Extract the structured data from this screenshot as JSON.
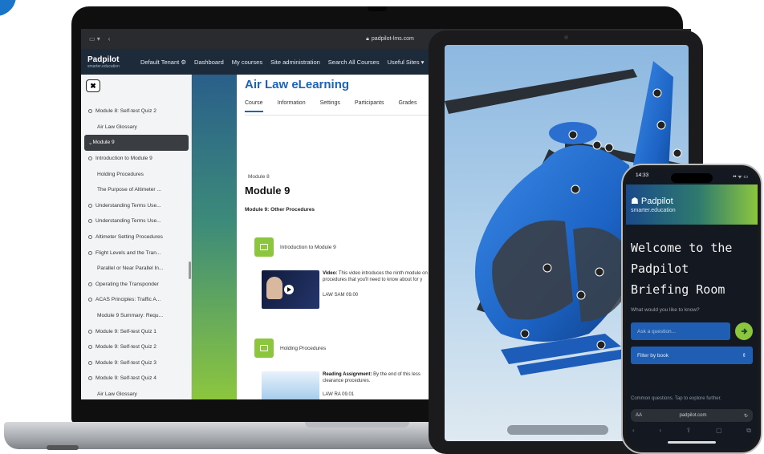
{
  "colors": {
    "accent": "#1c63b7",
    "brand_green": "#8cc63f",
    "nav_bg": "#1c2a3a",
    "heli_blue": "#1e6fcf"
  },
  "browser": {
    "url": "padpilot-lms.com"
  },
  "app_nav": {
    "brand": "Padpilot",
    "brand_tagline": "smarter.education",
    "items": [
      "Default Tenant ⚙",
      "Dashboard",
      "My courses",
      "Site administration",
      "Search All Courses",
      "Useful Sites ▾"
    ]
  },
  "sidebar": {
    "close_label": "✖",
    "items": [
      {
        "label": "Module 8: Self-test Quiz 2",
        "type": "page"
      },
      {
        "label": "Air Law Glossary",
        "type": "page"
      },
      {
        "label": "Module 9",
        "type": "section"
      },
      {
        "label": "Introduction to Module 9",
        "type": "page"
      },
      {
        "label": "Holding Procedures",
        "type": "page"
      },
      {
        "label": "The Purpose of Altimeter ...",
        "type": "page"
      },
      {
        "label": "Understanding Terms Use...",
        "type": "page"
      },
      {
        "label": "Understanding Terms Use...",
        "type": "page"
      },
      {
        "label": "Altimeter Setting Procedures",
        "type": "page"
      },
      {
        "label": "Flight Levels and the Tran...",
        "type": "page"
      },
      {
        "label": "Parallel or Near Parallel In...",
        "type": "page"
      },
      {
        "label": "Operating the Transponder",
        "type": "page"
      },
      {
        "label": "ACAS Principles: Traffic A...",
        "type": "page"
      },
      {
        "label": "Module 9 Summary: Requ...",
        "type": "page"
      },
      {
        "label": "Module 9: Self-test Quiz 1",
        "type": "page"
      },
      {
        "label": "Module 9: Self-test Quiz 2",
        "type": "page"
      },
      {
        "label": "Module 9: Self-test Quiz 3",
        "type": "page"
      },
      {
        "label": "Module 9: Self-test Quiz 4",
        "type": "page"
      },
      {
        "label": "Air Law Glossary",
        "type": "page"
      }
    ]
  },
  "course": {
    "title": "Air Law eLearning",
    "tabs": [
      "Course",
      "Information",
      "Settings",
      "Participants",
      "Grades"
    ],
    "module_kicker": "Module 8",
    "module_title": "Module 9",
    "module_subtitle": "Module 9: Other Procedures",
    "activity1": "Introduction to Module 9",
    "video_desc_bold": "Video:",
    "video_desc": " This video introduces the ninth module on procedures that you'll need to know about for y",
    "video_code": "LAW SAM 09.00",
    "activity2": "Holding Procedures",
    "reading_bold": "Reading Assignment:",
    "reading_desc": " By the end of this less clearance procedures.",
    "reading_code": "LAW RA 09.01"
  },
  "phone": {
    "time": "14:33",
    "status": "•• ᯤ ▭",
    "brand": "Padpilot",
    "tagline": "smarter.education",
    "welcome": "Welcome to the Padpilot Briefing Room",
    "prompt": "What would you like to know?",
    "input_placeholder": "Ask a question...",
    "filter_label": "Filter by book",
    "common": "Common questions. Tap to explore further.",
    "url_left": "AA",
    "url": "padpilot.com",
    "toolbar": [
      "‹",
      "›",
      "⇪",
      "▢",
      "⧉"
    ]
  }
}
